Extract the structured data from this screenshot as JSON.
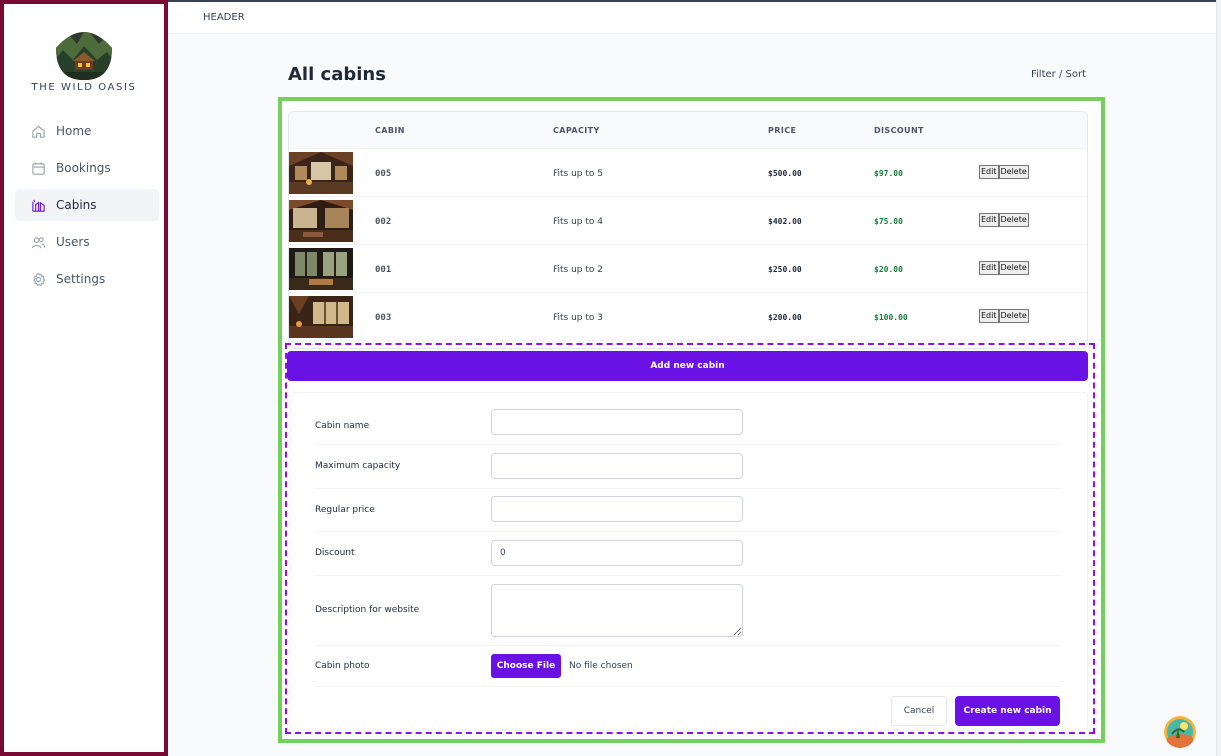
{
  "brand": {
    "name": "THE WILD OASIS"
  },
  "sidebar": {
    "items": [
      {
        "label": "Home",
        "icon": "home-icon"
      },
      {
        "label": "Bookings",
        "icon": "calendar-icon"
      },
      {
        "label": "Cabins",
        "icon": "cabins-icon",
        "active": true
      },
      {
        "label": "Users",
        "icon": "users-icon"
      },
      {
        "label": "Settings",
        "icon": "gear-icon"
      }
    ]
  },
  "header": {
    "text": "HEADER"
  },
  "page": {
    "title": "All cabins",
    "filter_sort": "Filter / Sort"
  },
  "table": {
    "columns": [
      "",
      "CABIN",
      "CAPACITY",
      "PRICE",
      "DISCOUNT",
      ""
    ],
    "rows": [
      {
        "name": "005",
        "capacity": "Fits up to 5",
        "price": "$500.00",
        "discount": "$97.00"
      },
      {
        "name": "002",
        "capacity": "Fits up to 4",
        "price": "$402.00",
        "discount": "$75.00"
      },
      {
        "name": "001",
        "capacity": "Fits up to 2",
        "price": "$250.00",
        "discount": "$20.00"
      },
      {
        "name": "003",
        "capacity": "Fits up to 3",
        "price": "$200.00",
        "discount": "$100.00"
      }
    ],
    "edit_label": "Edit",
    "delete_label": "Delete"
  },
  "form": {
    "add_button": "Add new cabin",
    "fields": {
      "name_label": "Cabin name",
      "name_value": "",
      "capacity_label": "Maximum capacity",
      "capacity_value": "",
      "price_label": "Regular price",
      "price_value": "",
      "discount_label": "Discount",
      "discount_value": "0",
      "description_label": "Description for website",
      "description_value": "",
      "photo_label": "Cabin photo",
      "file_button": "Choose File",
      "file_status": "No file chosen"
    },
    "cancel": "Cancel",
    "submit": "Create new cabin"
  },
  "colors": {
    "accent": "#6a11e6",
    "sidebar_border": "#7b0a33",
    "table_outline": "#74d05d",
    "form_outline": "#8f10e8",
    "discount": "#15803d"
  }
}
